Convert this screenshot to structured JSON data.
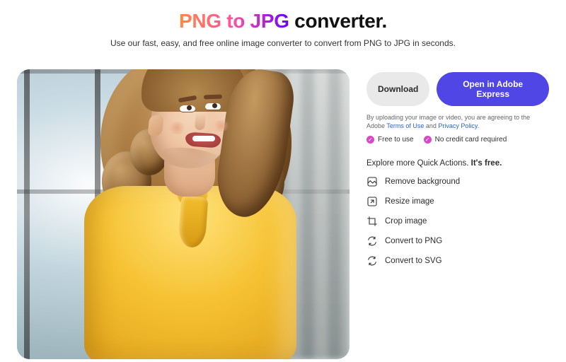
{
  "header": {
    "title_grad": "PNG to JPG",
    "title_rest": " converter.",
    "subtitle": "Use our fast, easy, and free online image converter to convert from PNG to JPG in seconds."
  },
  "buttons": {
    "download": "Download",
    "open": "Open in Adobe Express"
  },
  "legal": {
    "prefix": "By uploading your image or video, you are agreeing to the Adobe ",
    "terms": "Terms of Use",
    "and": " and ",
    "privacy": "Privacy Policy",
    "suffix": "."
  },
  "chips": {
    "free": "Free to use",
    "nocard": "No credit card required"
  },
  "explore": {
    "prefix": "Explore more Quick Actions. ",
    "bold": "It's free."
  },
  "quick_actions": [
    {
      "label": "Remove background"
    },
    {
      "label": "Resize image"
    },
    {
      "label": "Crop image"
    },
    {
      "label": "Convert to PNG"
    },
    {
      "label": "Convert to SVG"
    }
  ]
}
